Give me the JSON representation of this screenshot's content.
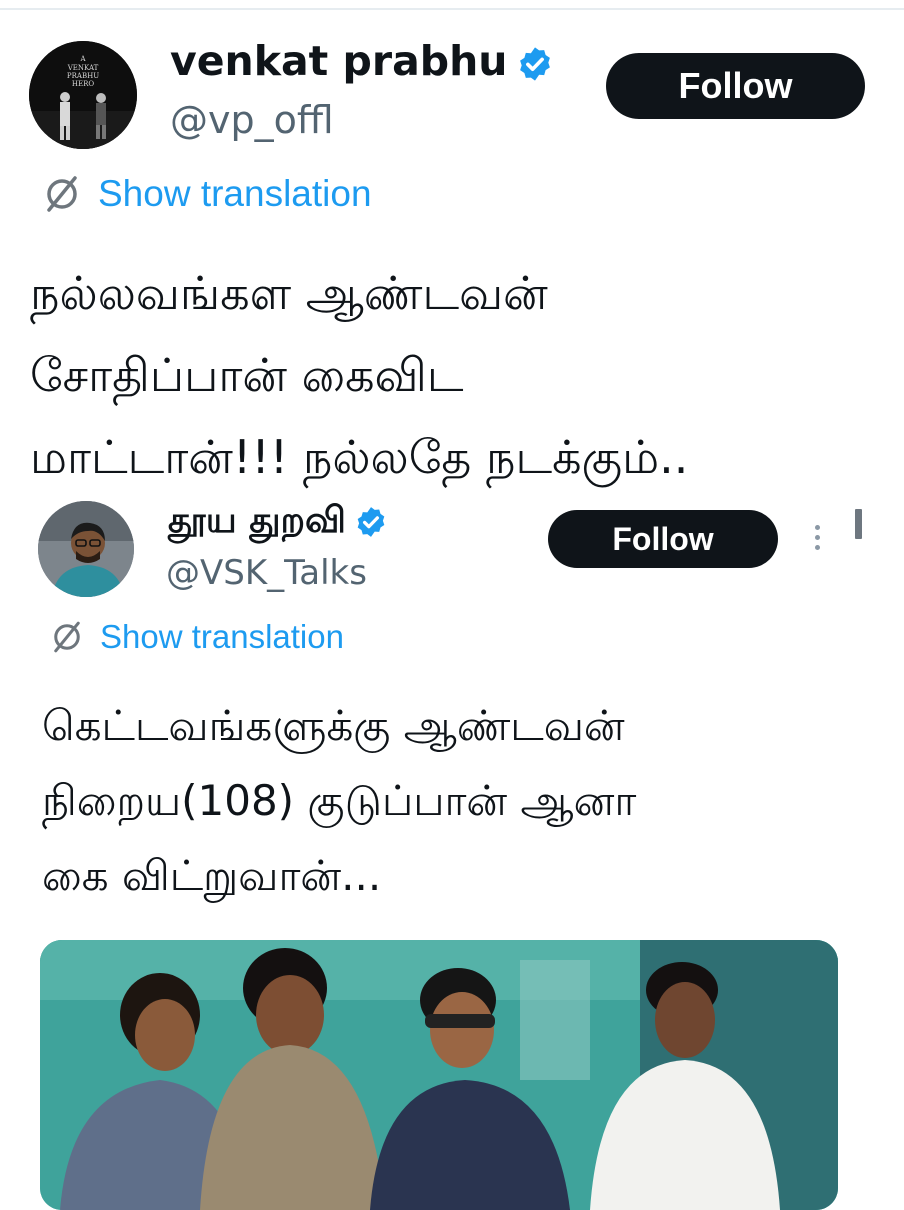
{
  "tweet": {
    "author": {
      "display_name": "venkat prabhu",
      "handle": "@vp_offl",
      "avatar_text": "A VENKAT PRABHU HERO",
      "verified_icon": "verified-badge-icon"
    },
    "follow_label": "Follow",
    "show_translation": "Show translation",
    "text": "நல்லவங்கள ஆண்டவன்\nசோதிப்பான் கைவிட\nமாட்டான்!!! நல்லதே நடக்கும்.."
  },
  "quoted_tweet": {
    "author": {
      "display_name": "தூய துறவி",
      "handle": "@VSK_Talks",
      "verified_icon": "verified-badge-icon"
    },
    "follow_label": "Follow",
    "show_translation": "Show translation",
    "text": "கெட்டவங்களுக்கு ஆண்டவன்\nநிறைய(108) குடுப்பான் ஆனா\nகை விட்றுவான்...",
    "media": {
      "icon": "photo-four-men-icon"
    }
  },
  "colors": {
    "accent": "#1d9bf0",
    "button_bg": "#0f1419",
    "text": "#0f1419",
    "secondary_text": "#536471"
  }
}
